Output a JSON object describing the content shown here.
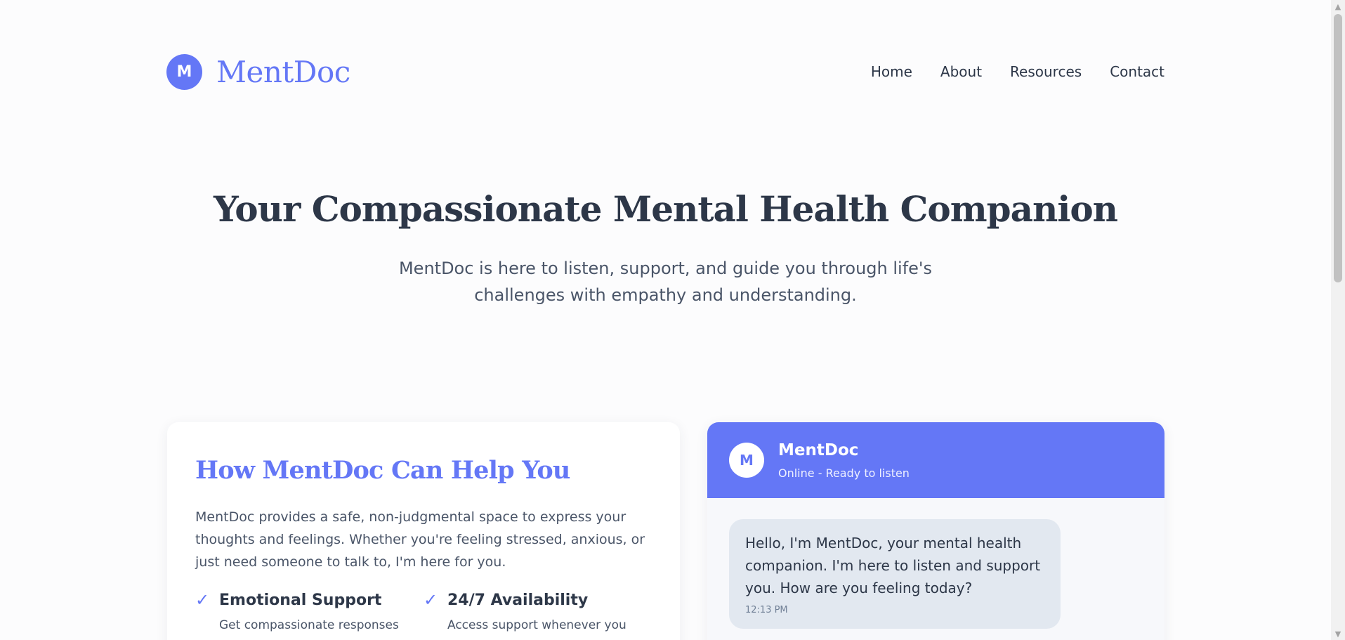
{
  "brand": {
    "logo_letter": "M",
    "name": "MentDoc"
  },
  "nav": [
    "Home",
    "About",
    "Resources",
    "Contact"
  ],
  "hero": {
    "title": "Your Compassionate Mental Health Companion",
    "subtitle": "MentDoc is here to listen, support, and guide you through life's challenges with empathy and understanding."
  },
  "help": {
    "title": "How MentDoc Can Help You",
    "text": "MentDoc provides a safe, non-judgmental space to express your thoughts and feelings. Whether you're feeling stressed, anxious, or just need someone to talk to, I'm here for you.",
    "features": [
      {
        "icon": "check-icon",
        "title": "Emotional Support",
        "desc": "Get compassionate responses"
      },
      {
        "icon": "check-icon",
        "title": "24/7 Availability",
        "desc": "Access support whenever you"
      }
    ]
  },
  "chat": {
    "avatar_letter": "M",
    "name": "MentDoc",
    "status": "Online - Ready to listen",
    "messages": [
      {
        "text": "Hello, I'm MentDoc, your mental health companion. I'm here to listen and support you. How are you feeling today?",
        "time": "12:13 PM"
      }
    ]
  },
  "colors": {
    "accent": "#6477f6",
    "text": "#2d3748",
    "bubble": "#e2e8f0",
    "background": "#fcfcfd"
  }
}
